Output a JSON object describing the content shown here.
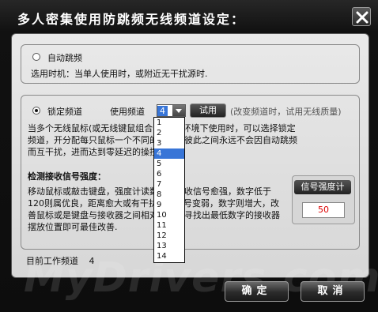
{
  "window": {
    "title": "多人密集使用防跳频无线频道设定："
  },
  "auto_hop": {
    "label": "自动跳频",
    "desc": "选用时机：当单人使用时，或附近无干扰源时."
  },
  "lock": {
    "label": "锁定频道",
    "channel_label": "使用频道",
    "channel_value": "4",
    "test_button": "试用",
    "hint": "(改变频道时，试用无线质量)",
    "desc": "当多个无线鼠标(或无线键鼠组合)在同一环境下使用时，可以选择锁定频道，开分配每只鼠标一个不同的频道，彼此之间永远不会因自动跳频而互干扰，进而达到零延迟的操控性.",
    "signal_title": "检测接收信号强度：",
    "signal_desc": "移动鼠标或敲击键盘，强度计读数越小接收信号愈强，数字低于120则属优良，距离愈大或有干扰造成信号变弱，数字则增大，改善鼠标或是键盘与接收器之间相对位置并寻找出最低数字的接收器摆放位置即可最佳改善.",
    "channel_options": [
      "1",
      "2",
      "3",
      "4",
      "5",
      "6",
      "7",
      "8",
      "9",
      "10",
      "11",
      "12",
      "13",
      "14"
    ],
    "selected_index": 3
  },
  "meter": {
    "label": "信号强度计",
    "value": "50"
  },
  "status": {
    "label": "目前工作频道",
    "value": "4"
  },
  "buttons": {
    "ok": "确定",
    "cancel": "取消"
  },
  "watermark": "MyDrivers.com"
}
